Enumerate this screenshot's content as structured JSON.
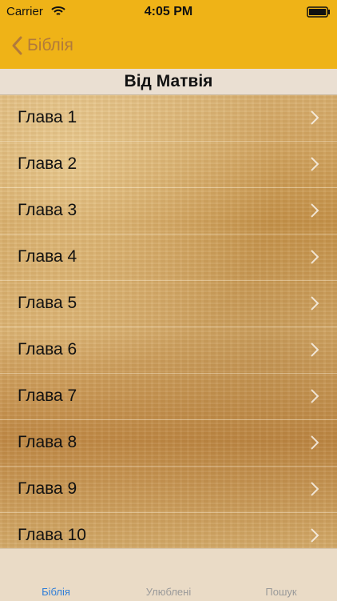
{
  "status_bar": {
    "carrier": "Carrier",
    "time": "4:05 PM"
  },
  "nav": {
    "back_label": "Біблія"
  },
  "section": {
    "title": "Від Матвія"
  },
  "chapters": [
    "Глава 1",
    "Глава 2",
    "Глава 3",
    "Глава 4",
    "Глава 5",
    "Глава 6",
    "Глава 7",
    "Глава 8",
    "Глава 9",
    "Глава 10"
  ],
  "tabs": [
    {
      "label": "Біблія",
      "active": true
    },
    {
      "label": "Улюблені",
      "active": false
    },
    {
      "label": "Пошук",
      "active": false
    }
  ],
  "colors": {
    "accent_bar": "#efb317",
    "back_text": "#b17a3b",
    "tab_active": "#2f7ed8",
    "tab_inactive": "#9a9a9a"
  },
  "icons": {
    "wifi": "wifi-icon",
    "battery": "battery-icon",
    "back": "chevron-left-icon",
    "row_disclosure": "chevron-right-icon"
  }
}
